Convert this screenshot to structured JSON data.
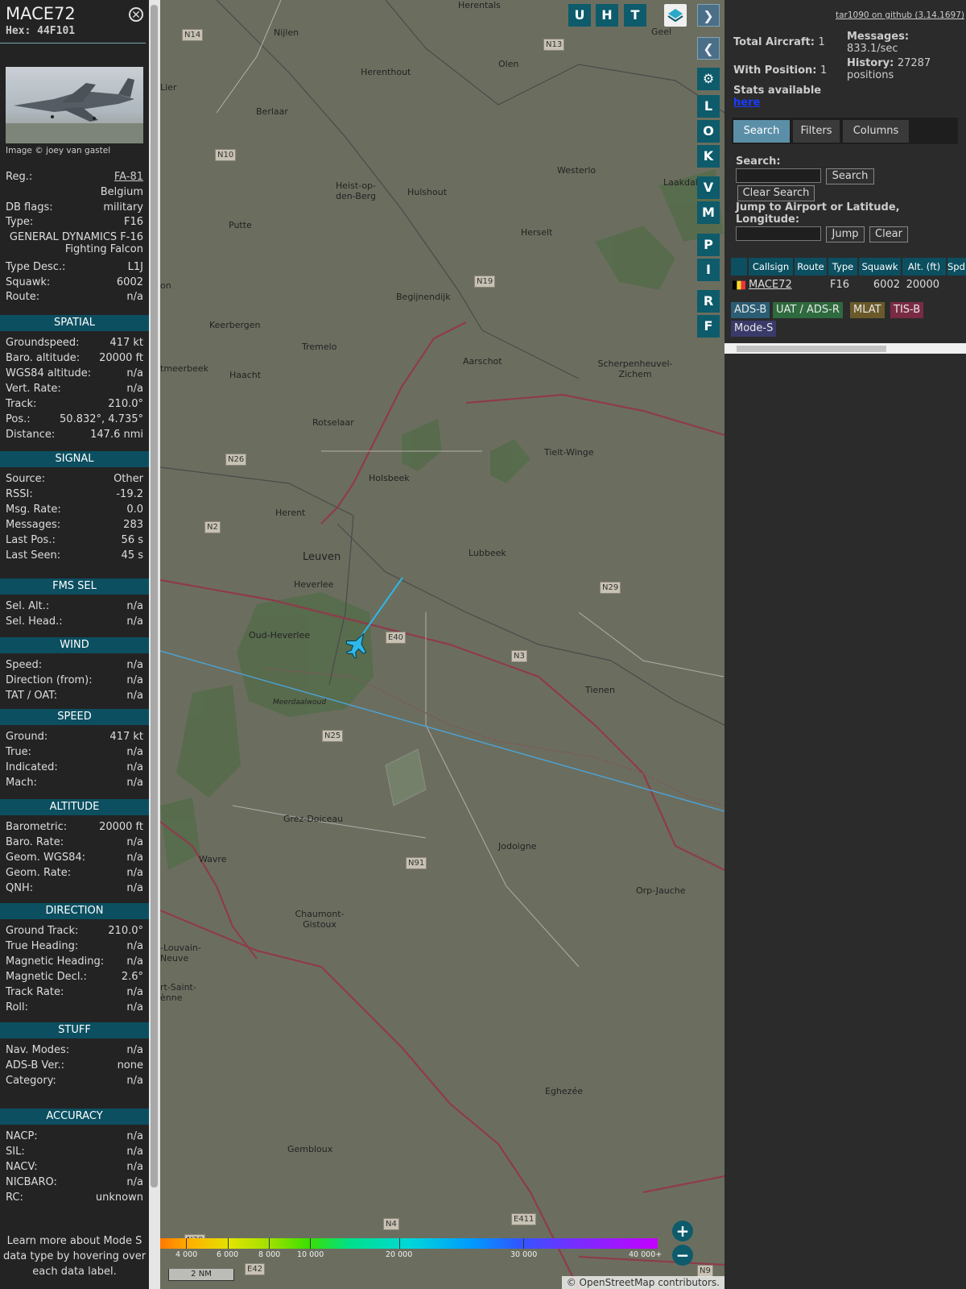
{
  "aircraft": {
    "callsign": "MACE72",
    "hex": "Hex: 44F101",
    "photo_credit": "Image © joey van gastel",
    "details": [
      {
        "k": "Reg.:",
        "v": "FA-81"
      },
      {
        "k": "",
        "v": "Belgium"
      },
      {
        "k": "DB flags:",
        "v": "military"
      },
      {
        "k": "Type:",
        "v": "F16"
      }
    ],
    "type_full": "GENERAL DYNAMICS F-16 Fighting Falcon",
    "details2": [
      {
        "k": "Type Desc.:",
        "v": "L1J"
      },
      {
        "k": "Squawk:",
        "v": "6002"
      },
      {
        "k": "Route:",
        "v": "n/a"
      }
    ]
  },
  "sections": {
    "spatial": {
      "title": "SPATIAL",
      "rows": [
        {
          "k": "Groundspeed:",
          "v": "417 kt"
        },
        {
          "k": "Baro. altitude:",
          "v": "20000 ft"
        },
        {
          "k": "WGS84 altitude:",
          "v": "n/a"
        },
        {
          "k": "Vert. Rate:",
          "v": "n/a"
        },
        {
          "k": "Track:",
          "v": "210.0°"
        },
        {
          "k": "Pos.:",
          "v": "50.832°, 4.735°"
        },
        {
          "k": "Distance:",
          "v": "147.6 nmi"
        }
      ]
    },
    "signal": {
      "title": "SIGNAL",
      "rows": [
        {
          "k": "Source:",
          "v": "Other"
        },
        {
          "k": "RSSI:",
          "v": "-19.2"
        },
        {
          "k": "Msg. Rate:",
          "v": "0.0"
        },
        {
          "k": "Messages:",
          "v": "283"
        },
        {
          "k": "Last Pos.:",
          "v": "56 s"
        },
        {
          "k": "Last Seen:",
          "v": "45 s"
        }
      ]
    },
    "fms": {
      "title": "FMS SEL",
      "rows": [
        {
          "k": "Sel. Alt.:",
          "v": "n/a"
        },
        {
          "k": "Sel. Head.:",
          "v": "n/a"
        }
      ]
    },
    "wind": {
      "title": "WIND",
      "rows": [
        {
          "k": "Speed:",
          "v": "n/a"
        },
        {
          "k": "Direction (from):",
          "v": "n/a"
        },
        {
          "k": "TAT / OAT:",
          "v": "n/a"
        }
      ]
    },
    "speed": {
      "title": "SPEED",
      "rows": [
        {
          "k": "Ground:",
          "v": "417 kt"
        },
        {
          "k": "True:",
          "v": "n/a"
        },
        {
          "k": "Indicated:",
          "v": "n/a"
        },
        {
          "k": "Mach:",
          "v": "n/a"
        }
      ]
    },
    "altitude": {
      "title": "ALTITUDE",
      "rows": [
        {
          "k": "Barometric:",
          "v": "20000 ft"
        },
        {
          "k": "Baro. Rate:",
          "v": "n/a"
        },
        {
          "k": "Geom. WGS84:",
          "v": "n/a"
        },
        {
          "k": "Geom. Rate:",
          "v": "n/a"
        },
        {
          "k": "QNH:",
          "v": "n/a"
        }
      ]
    },
    "direction": {
      "title": "DIRECTION",
      "rows": [
        {
          "k": "Ground Track:",
          "v": "210.0°"
        },
        {
          "k": "True Heading:",
          "v": "n/a"
        },
        {
          "k": "Magnetic Heading:",
          "v": "n/a"
        },
        {
          "k": "Magnetic Decl.:",
          "v": "2.6°"
        },
        {
          "k": "Track Rate:",
          "v": "n/a"
        },
        {
          "k": "Roll:",
          "v": "n/a"
        }
      ]
    },
    "stuff": {
      "title": "STUFF",
      "rows": [
        {
          "k": "Nav. Modes:",
          "v": "n/a"
        },
        {
          "k": "ADS-B Ver.:",
          "v": "none"
        },
        {
          "k": "Category:",
          "v": "n/a"
        }
      ]
    },
    "accuracy": {
      "title": "ACCURACY",
      "rows": [
        {
          "k": "NACP:",
          "v": "n/a"
        },
        {
          "k": "SIL:",
          "v": "n/a"
        },
        {
          "k": "NACV:",
          "v": "n/a"
        },
        {
          "k": "NICBARO:",
          "v": "n/a"
        },
        {
          "k": "RC:",
          "v": "unknown"
        }
      ]
    }
  },
  "note": "Learn more about Mode S data type by hovering over each data label.",
  "map": {
    "buttons": [
      "U",
      "H",
      "T"
    ],
    "side_buttons": [
      "L",
      "O",
      "K",
      "V",
      "M",
      "P",
      "I",
      "R",
      "F"
    ],
    "towns": [
      "Herentals",
      "Geel",
      "Nijlen",
      "Olen",
      "Herenthout",
      "Lier",
      "Berlaar",
      "Westerlo",
      "Laakdal",
      "Heist-op-den-Berg",
      "Hulshout",
      "Putte",
      "Herselt",
      "Begijnendijk",
      "Keerbergen",
      "Tremelo",
      "Aarschot",
      "Scherpenheuvel-Zichem",
      "Haacht",
      "Rotselaar",
      "Tielt-Winge",
      "Holsbeek",
      "Herent",
      "Leuven",
      "Lubbeek",
      "Heverlee",
      "Oud-Heverlee",
      "Tienen",
      "Meerdaalwoud",
      "Grez-Doiceau",
      "Jodoigne",
      "Wavre",
      "Orp-Jauche",
      "Chaumont-Gistoux",
      "Eghezée",
      "Gembloux",
      "tmeerbeek",
      "-Louvain-Neuve",
      "rt-Saint-ènne",
      "on"
    ],
    "roads": [
      "N14",
      "N13",
      "N10",
      "N19",
      "N26",
      "N2",
      "N29",
      "E40",
      "N3",
      "N25",
      "N91",
      "N4",
      "E411",
      "N30",
      "E42",
      "N9"
    ],
    "altitude_scale": [
      "4 000",
      "6 000",
      "8 000",
      "10 000",
      "20 000",
      "30 000",
      "40 000+"
    ],
    "distance_scale": "2 NM",
    "attribution": "© OpenStreetMap contributors."
  },
  "panel": {
    "github_link": "tar1090 on github (3.14.1697)",
    "total_aircraft_label": "Total Aircraft:",
    "total_aircraft": "1",
    "with_position_label": "With Position:",
    "with_position": "1",
    "messages_label": "Messages:",
    "messages_value": "833.1/sec",
    "history_label": "History:",
    "history_value": "27287 positions",
    "stats_label": "Stats available",
    "stats_link": "here",
    "tabs": [
      "Search",
      "Filters",
      "Columns"
    ],
    "search_label": "Search:",
    "search_button": "Search",
    "clear_search_button": "Clear Search",
    "jump_label": "Jump to Airport or Latitude, Longitude:",
    "jump_button": "Jump",
    "clear_button": "Clear",
    "table_headers": [
      "Callsign",
      "Route",
      "Type",
      "Squawk",
      "Alt. (ft)",
      "Spd."
    ],
    "table_rows": [
      {
        "callsign": "MACE72",
        "route": "",
        "type": "F16",
        "squawk": "6002",
        "alt": "20000",
        "spd": ""
      }
    ],
    "badges": [
      {
        "label": "ADS-B",
        "color": "#2b5d74"
      },
      {
        "label": "UAT / ADS-R",
        "color": "#2e6a3d"
      },
      {
        "label": "MLAT",
        "color": "#6a5a2a"
      },
      {
        "label": "TIS-B",
        "color": "#7a2b44"
      },
      {
        "label": "Mode-S",
        "color": "#3a3a6a"
      }
    ]
  }
}
